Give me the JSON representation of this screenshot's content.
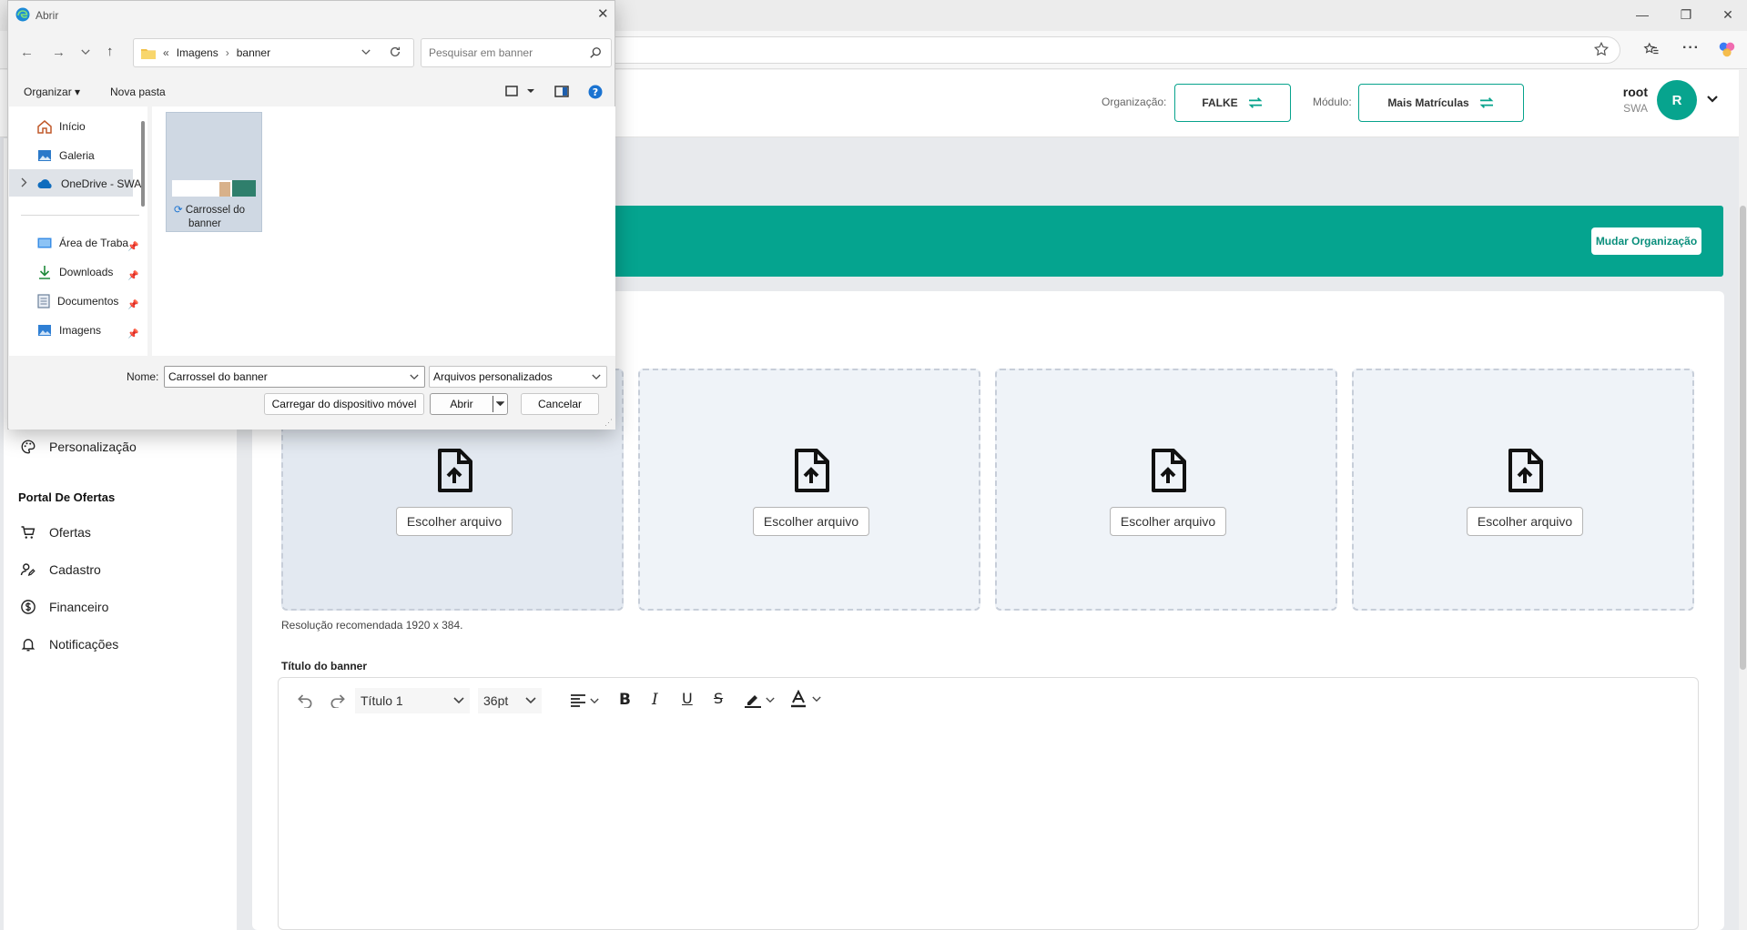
{
  "browser": {
    "window_controls": [
      "—",
      "❐",
      "✕"
    ]
  },
  "header": {
    "org_label": "Organização:",
    "org_value": "FALKE",
    "module_label": "Módulo:",
    "module_value": "Mais Matrículas",
    "user_name": "root",
    "user_org": "SWA",
    "avatar_letter": "R"
  },
  "sidebar": {
    "items_top": [
      {
        "label": "Personalização",
        "icon": "palette-icon"
      }
    ],
    "section_title": "Portal De Ofertas",
    "items": [
      {
        "label": "Ofertas",
        "icon": "cart-icon"
      },
      {
        "label": "Cadastro",
        "icon": "user-edit-icon"
      },
      {
        "label": "Financeiro",
        "icon": "dollar-icon"
      },
      {
        "label": "Notificações",
        "icon": "bell-icon"
      }
    ]
  },
  "banner": {
    "button_label": "Mudar Organização",
    "color": "#05a48f"
  },
  "upload": {
    "choose_labels": [
      "Escolher arquivo",
      "Escolher arquivo",
      "Escolher arquivo",
      "Escolher arquivo"
    ],
    "hint": "Resolução recomendada 1920 x 384."
  },
  "editor": {
    "field_label": "Título do banner",
    "heading_select": "Título 1",
    "size_select": "36pt"
  },
  "dialog": {
    "title": "Abrir",
    "breadcrumb": [
      "Imagens",
      "banner"
    ],
    "search_placeholder": "Pesquisar em banner",
    "organize_label": "Organizar ▾",
    "new_folder_label": "Nova pasta",
    "nav_items": [
      {
        "label": "Início",
        "icon": "home-icon"
      },
      {
        "label": "Galeria",
        "icon": "gallery-icon"
      },
      {
        "label": "OneDrive - SWA",
        "icon": "cloud-icon"
      },
      {
        "label": "Área de Traba",
        "icon": "desktop-icon"
      },
      {
        "label": "Downloads",
        "icon": "download-icon"
      },
      {
        "label": "Documentos",
        "icon": "document-icon"
      },
      {
        "label": "Imagens",
        "icon": "image-icon"
      }
    ],
    "file_name": "Carrossel do banner",
    "file_tile_line1": "Carrossel do",
    "file_tile_line2": "banner",
    "name_label": "Nome:",
    "file_type": "Arquivos personalizados",
    "mobile_button": "Carregar do dispositivo móvel",
    "open_button": "Abrir",
    "cancel_button": "Cancelar"
  }
}
